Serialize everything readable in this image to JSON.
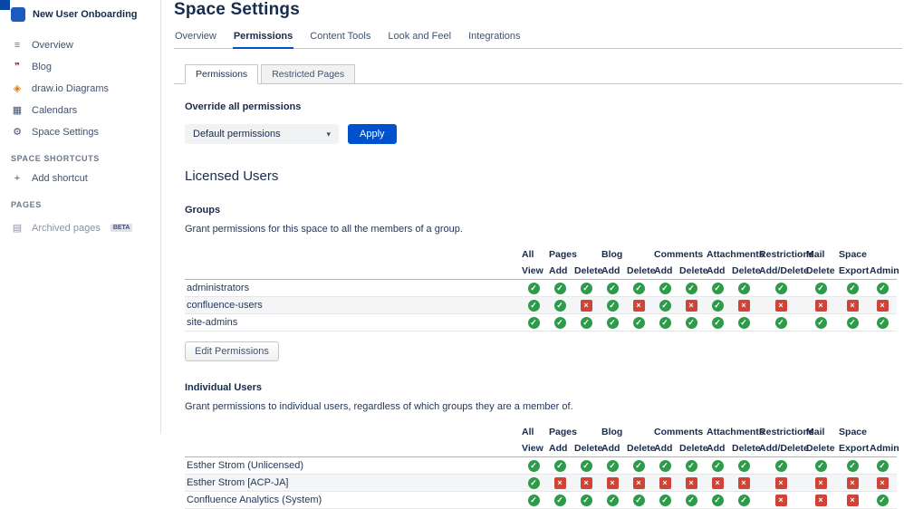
{
  "sidebar": {
    "space_name": "New User Onboarding",
    "items": [
      {
        "label": "Overview",
        "icon": "overview-icon"
      },
      {
        "label": "Blog",
        "icon": "blog-icon"
      },
      {
        "label": "draw.io Diagrams",
        "icon": "drawio-icon"
      },
      {
        "label": "Calendars",
        "icon": "calendar-icon"
      },
      {
        "label": "Space Settings",
        "icon": "gear-icon"
      }
    ],
    "sections": [
      {
        "title": "SPACE SHORTCUTS",
        "items": [
          {
            "label": "Add shortcut",
            "icon": "plus-icon"
          }
        ]
      },
      {
        "title": "PAGES",
        "items": [
          {
            "label": "Archived pages",
            "icon": "archive-icon",
            "badge": "BETA",
            "muted": true
          }
        ]
      }
    ]
  },
  "main": {
    "title": "Space Settings",
    "tabs": [
      {
        "label": "Overview",
        "active": false
      },
      {
        "label": "Permissions",
        "active": true
      },
      {
        "label": "Content Tools",
        "active": false
      },
      {
        "label": "Look and Feel",
        "active": false
      },
      {
        "label": "Integrations",
        "active": false
      }
    ],
    "subtabs": [
      {
        "label": "Permissions",
        "active": true
      },
      {
        "label": "Restricted Pages",
        "active": false
      }
    ],
    "override": {
      "label": "Override all permissions",
      "dropdown_value": "Default permissions",
      "apply_label": "Apply"
    },
    "licensed_users_title": "Licensed Users",
    "groups": {
      "title": "Groups",
      "description": "Grant permissions for this space to all the members of a group.",
      "edit_button": "Edit Permissions"
    },
    "individual": {
      "title": "Individual Users",
      "description": "Grant permissions to individual users, regardless of which groups they are a member of."
    },
    "table": {
      "group_headers": [
        {
          "label": "All",
          "span": 1
        },
        {
          "label": "Pages",
          "span": 2
        },
        {
          "label": "Blog",
          "span": 2
        },
        {
          "label": "Comments",
          "span": 2
        },
        {
          "label": "Attachments",
          "span": 2
        },
        {
          "label": "Restrictions",
          "span": 1
        },
        {
          "label": "Mail",
          "span": 1
        },
        {
          "label": "Space",
          "span": 2
        }
      ],
      "sub_headers": [
        "View",
        "Add",
        "Delete",
        "Add",
        "Delete",
        "Add",
        "Delete",
        "Add",
        "Delete",
        "Add/Delete",
        "Delete",
        "Export",
        "Admin"
      ],
      "groups_rows": [
        {
          "name": "administrators",
          "perms": [
            "y",
            "y",
            "y",
            "y",
            "y",
            "y",
            "y",
            "y",
            "y",
            "y",
            "y",
            "y",
            "y"
          ]
        },
        {
          "name": "confluence-users",
          "perms": [
            "y",
            "y",
            "n",
            "y",
            "n",
            "y",
            "n",
            "y",
            "n",
            "n",
            "n",
            "n",
            "n"
          ]
        },
        {
          "name": "site-admins",
          "perms": [
            "y",
            "y",
            "y",
            "y",
            "y",
            "y",
            "y",
            "y",
            "y",
            "y",
            "y",
            "y",
            "y"
          ]
        }
      ],
      "individual_rows": [
        {
          "name": "Esther Strom (Unlicensed)",
          "perms": [
            "y",
            "y",
            "y",
            "y",
            "y",
            "y",
            "y",
            "y",
            "y",
            "y",
            "y",
            "y",
            "y"
          ]
        },
        {
          "name": "Esther Strom [ACP-JA]",
          "perms": [
            "y",
            "n",
            "n",
            "n",
            "n",
            "n",
            "n",
            "n",
            "n",
            "n",
            "n",
            "n",
            "n"
          ]
        },
        {
          "name": "Confluence Analytics (System)",
          "perms": [
            "y",
            "y",
            "y",
            "y",
            "y",
            "y",
            "y",
            "y",
            "y",
            "n",
            "n",
            "n",
            "y"
          ]
        }
      ]
    },
    "colors": {
      "granted": "#2e9b4a",
      "denied": "#d04437",
      "accent": "#0052cc",
      "logo": "#0747a6"
    }
  }
}
